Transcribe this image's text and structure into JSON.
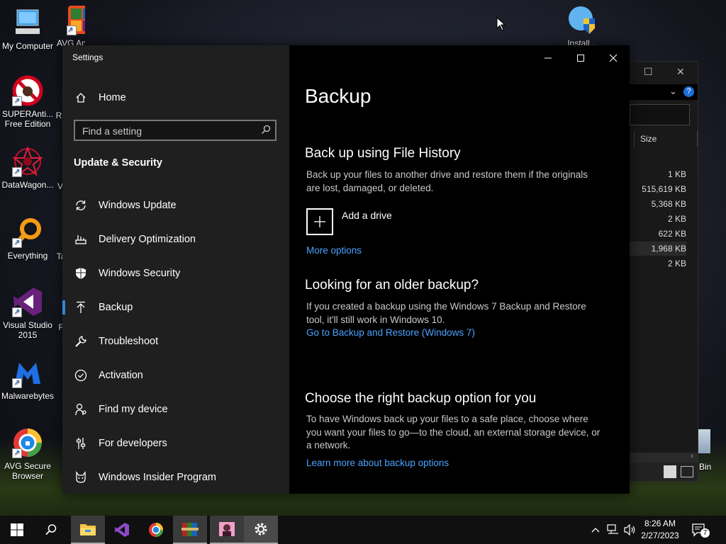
{
  "desktop": {
    "icons": [
      {
        "label": "My Computer"
      },
      {
        "label": "AVG AntiV..."
      },
      {
        "label": "SUPERAnti... Free Edition"
      },
      {
        "label": "R"
      },
      {
        "label": "DataWagon..."
      },
      {
        "label": "V"
      },
      {
        "label": "Everything"
      },
      {
        "label": "Ta"
      },
      {
        "label": "Visual Studio 2015"
      },
      {
        "label": "F"
      },
      {
        "label": "Malwarebytes"
      },
      {
        "label": "AVG Secure Browser"
      },
      {
        "label": "Install..."
      },
      {
        "label": "Bin"
      }
    ]
  },
  "explorer": {
    "column_header": "Size",
    "sizes": [
      "1 KB",
      "515,619 KB",
      "5,368 KB",
      "2 KB",
      "622 KB",
      "1,968 KB",
      "2 KB"
    ]
  },
  "settings": {
    "app_title": "Settings",
    "home_label": "Home",
    "search_placeholder": "Find a setting",
    "section_title": "Update & Security",
    "nav_items": [
      {
        "label": "Windows Update",
        "icon": "sync-icon"
      },
      {
        "label": "Delivery Optimization",
        "icon": "delivery-optimization-icon"
      },
      {
        "label": "Windows Security",
        "icon": "shield-icon"
      },
      {
        "label": "Backup",
        "icon": "backup-arrow-icon",
        "selected": true
      },
      {
        "label": "Troubleshoot",
        "icon": "wrench-icon"
      },
      {
        "label": "Activation",
        "icon": "check-circle-icon"
      },
      {
        "label": "Find my device",
        "icon": "person-pin-icon"
      },
      {
        "label": "For developers",
        "icon": "developer-sliders-icon"
      },
      {
        "label": "Windows Insider Program",
        "icon": "insider-cat-icon"
      }
    ],
    "page": {
      "title": "Backup",
      "file_history": {
        "heading": "Back up using File History",
        "description": "Back up your files to another drive and restore them if the originals are lost, damaged, or deleted.",
        "add_drive": "Add a drive",
        "more_options": "More options"
      },
      "older_backup": {
        "heading": "Looking for an older backup?",
        "description": "If you created a backup using the Windows 7 Backup and Restore tool, it'll still work in Windows 10.",
        "link": "Go to Backup and Restore (Windows 7)"
      },
      "right_option": {
        "heading": "Choose the right backup option for you",
        "description": "To have Windows back up your files to a safe place, choose where you want your files to go—to the cloud, an external storage device, or a network.",
        "link": "Learn more about backup options"
      }
    }
  },
  "taskbar": {
    "time": "8:26 AM",
    "date": "2/27/2023",
    "notification_count": "7"
  },
  "colors": {
    "accent": "#2b88d8",
    "link": "#4aa3ff",
    "sidebar_bg": "#1f1f1f",
    "content_bg": "#000000"
  }
}
